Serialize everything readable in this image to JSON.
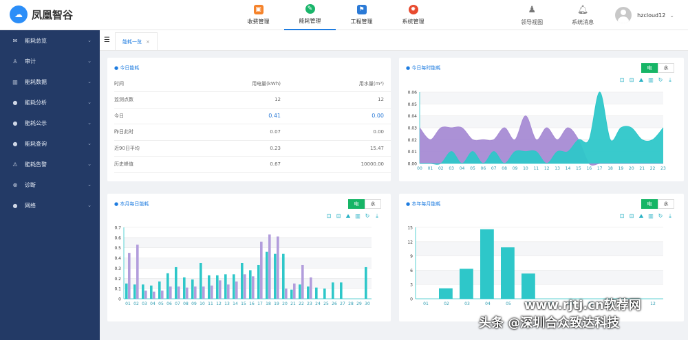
{
  "app": {
    "name": "凤凰智谷",
    "logo_icon": "cloud-icon"
  },
  "topnav": [
    {
      "label": "收费管理",
      "icon_color": "#f5832b",
      "active": false
    },
    {
      "label": "能耗管理",
      "icon_color": "#19b56a",
      "active": true
    },
    {
      "label": "工程管理",
      "icon_color": "#2b7ad6",
      "active": false
    },
    {
      "label": "系统管理",
      "icon_color": "#e84a2f",
      "active": false
    }
  ],
  "topright": {
    "leader_view": "领导视图",
    "messages": "系统消息",
    "user": "hzcloud12"
  },
  "sidebar": [
    {
      "label": "能耗总览",
      "icon": "✉"
    },
    {
      "label": "审计",
      "icon": "♙"
    },
    {
      "label": "能耗数据",
      "icon": "▥"
    },
    {
      "label": "能耗分析",
      "icon": "●"
    },
    {
      "label": "能耗公示",
      "icon": "●"
    },
    {
      "label": "能耗查询",
      "icon": "●"
    },
    {
      "label": "能耗告警",
      "icon": "⚠"
    },
    {
      "label": "诊断",
      "icon": "⊗"
    },
    {
      "label": "网络",
      "icon": "●"
    }
  ],
  "tab": {
    "label": "能耗一览",
    "close": "×"
  },
  "today": {
    "title": "今日能耗",
    "headers": [
      "时间",
      "用电量(kWh)",
      "用水量(m³)"
    ],
    "rows": [
      [
        "监测点数",
        "12",
        "12"
      ],
      [
        "今日",
        "0.41",
        "0.00"
      ],
      [
        "昨日此时",
        "0.07",
        "0.00"
      ],
      [
        "近90日平均",
        "0.23",
        "15.47"
      ],
      [
        "历史峰值",
        "0.67",
        "10000.00"
      ]
    ]
  },
  "toggle": {
    "electric": "电",
    "water": "水"
  },
  "hourly": {
    "title": "今日每时能耗",
    "chart_data": {
      "type": "area",
      "x": [
        "00",
        "01",
        "02",
        "03",
        "04",
        "05",
        "06",
        "07",
        "08",
        "09",
        "10",
        "11",
        "12",
        "13",
        "14",
        "15",
        "16",
        "17",
        "18",
        "19",
        "20",
        "21",
        "22",
        "23"
      ],
      "yticks": [
        "0.00",
        "0.01",
        "0.02",
        "0.03",
        "0.04",
        "0.05",
        "0.06"
      ],
      "ylim": [
        0,
        0.06
      ],
      "series": [
        {
          "color": "#a78bd4",
          "values": [
            0.03,
            0.02,
            0.03,
            0.03,
            0.03,
            0.02,
            0.02,
            0.02,
            0.03,
            0.02,
            0.04,
            0.02,
            0.03,
            0.02,
            0.03,
            0.02,
            0,
            0,
            0,
            0,
            0,
            0,
            0,
            0
          ]
        },
        {
          "color": "#2ec7c9",
          "values": [
            0,
            0,
            0,
            0.01,
            0,
            0.01,
            0,
            0.01,
            0,
            0.01,
            0.01,
            0.01,
            0,
            0.01,
            0.01,
            0.02,
            0.02,
            0.06,
            0.02,
            0.03,
            0.03,
            0.02,
            0.02,
            0.03
          ]
        }
      ]
    }
  },
  "daily": {
    "title": "本月每日能耗",
    "chart_data": {
      "type": "bar",
      "categories": [
        "01",
        "02",
        "03",
        "04",
        "05",
        "06",
        "07",
        "08",
        "09",
        "10",
        "11",
        "12",
        "13",
        "14",
        "15",
        "16",
        "17",
        "18",
        "19",
        "20",
        "21",
        "22",
        "23",
        "24",
        "25",
        "26",
        "27",
        "28",
        "29",
        "30"
      ],
      "yticks": [
        "0",
        "0.1",
        "0.2",
        "0.3",
        "0.4",
        "0.5",
        "0.6",
        "0.7"
      ],
      "ylim": [
        0,
        0.7
      ],
      "series": [
        {
          "color": "#2ec7c9",
          "values": [
            0.15,
            0.14,
            0.14,
            0.13,
            0.17,
            0.25,
            0.31,
            0.21,
            0.19,
            0.35,
            0.23,
            0.23,
            0.24,
            0.24,
            0.35,
            0.28,
            0.33,
            0.46,
            0.44,
            0.44,
            0.09,
            0.14,
            0.12,
            0.11,
            0.1,
            0.16,
            0.16,
            0,
            0,
            0.31
          ]
        },
        {
          "color": "#b29ddc",
          "values": [
            0.45,
            0.53,
            0.08,
            0.07,
            0.08,
            0.12,
            0.12,
            0.11,
            0.12,
            0.12,
            0.13,
            0.18,
            0.14,
            0.17,
            0.24,
            0.22,
            0.56,
            0.63,
            0.61,
            0.1,
            0.15,
            0.33,
            0.21,
            0,
            0,
            0,
            0,
            0,
            0,
            0
          ]
        }
      ]
    }
  },
  "monthly": {
    "title": "本年每月能耗",
    "chart_data": {
      "type": "bar",
      "categories": [
        "01",
        "02",
        "03",
        "04",
        "05",
        "06",
        "07",
        "08",
        "09",
        "10",
        "11",
        "12"
      ],
      "yticks": [
        "0",
        "3",
        "6",
        "9",
        "12",
        "15"
      ],
      "ylim": [
        0,
        15
      ],
      "series": [
        {
          "color": "#2ec7c9",
          "values": [
            0,
            2.2,
            6.3,
            14.6,
            10.8,
            5.3,
            0,
            0,
            0,
            0,
            0,
            0
          ]
        }
      ]
    }
  },
  "watermark": {
    "site": "www.rjtj.cn软荐网",
    "author": "头条 @深圳合众致达科技"
  }
}
